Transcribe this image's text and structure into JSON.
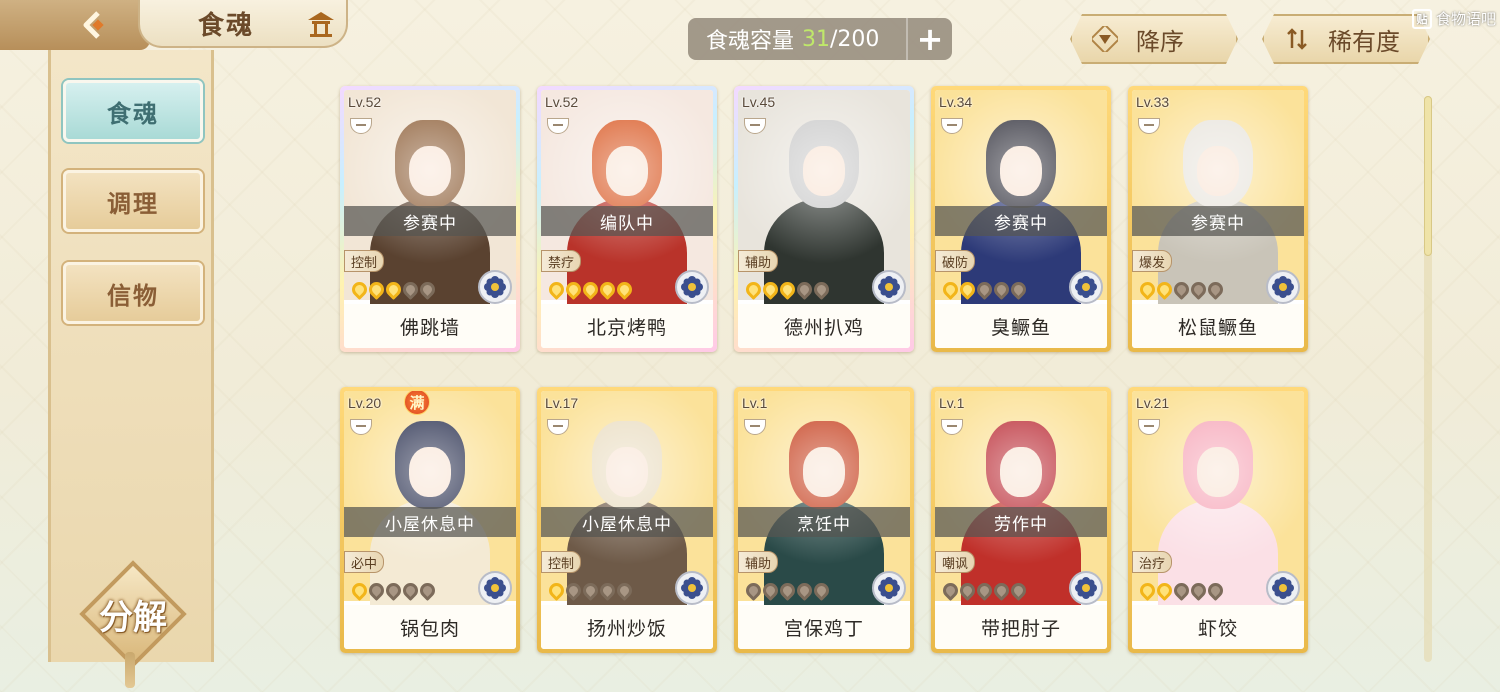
{
  "header": {
    "title": "食魂",
    "capacity_label": "食魂容量",
    "capacity_current": "31",
    "capacity_max": "/200",
    "add_label": "+",
    "sort_desc_label": "降序",
    "sort_rarity_label": "稀有度",
    "watermark_text": "食物语吧",
    "watermark_icon_text": "贴"
  },
  "sidebar": {
    "tabs": [
      {
        "label": "食魂",
        "active": true
      },
      {
        "label": "调理",
        "active": false
      },
      {
        "label": "信物",
        "active": false
      }
    ],
    "decompose_label": "分解"
  },
  "colors": {
    "gold_frame": "#e9b94a",
    "capacity_accent": "#bfe86a",
    "active_tab": "#a9dad6"
  },
  "cards": [
    {
      "name": "佛跳墙",
      "level": "Lv.52",
      "status": "参赛中",
      "role": "控制",
      "stars": 3,
      "frame": "rainbow",
      "full": false,
      "hair": "#8a5a32",
      "outfit": "#5a4230",
      "bg": "#f2e6d6"
    },
    {
      "name": "北京烤鸭",
      "level": "Lv.52",
      "status": "编队中",
      "role": "禁疗",
      "stars": 5,
      "frame": "rainbow",
      "full": false,
      "hair": "#d8541e",
      "outfit": "#b9332a",
      "bg": "#f5e8e0"
    },
    {
      "name": "德州扒鸡",
      "level": "Lv.45",
      "status": "",
      "role": "辅助",
      "stars": 3,
      "frame": "rainbow",
      "full": false,
      "hair": "#c9c9c9",
      "outfit": "#2f3530",
      "bg": "#e8e4dc"
    },
    {
      "name": "臭鳜鱼",
      "level": "Lv.34",
      "status": "参赛中",
      "role": "破防",
      "stars": 2,
      "frame": "gold",
      "full": false,
      "hair": "#2b2b36",
      "outfit": "#2d3a78",
      "bg": "#fbe29a"
    },
    {
      "name": "松鼠鳜鱼",
      "level": "Lv.33",
      "status": "参赛中",
      "role": "爆发",
      "stars": 2,
      "frame": "gold",
      "full": false,
      "hair": "#e8e4dc",
      "outfit": "#c9c4b8",
      "bg": "#fbe29a"
    },
    {
      "name": "锅包肉",
      "level": "Lv.20",
      "status": "小屋休息中",
      "role": "必中",
      "stars": 1,
      "frame": "gold",
      "full": true,
      "full_label": "满",
      "hair": "#232a4a",
      "outfit": "#f4ead4",
      "bg": "#fbe29a"
    },
    {
      "name": "扬州炒饭",
      "level": "Lv.17",
      "status": "小屋休息中",
      "role": "控制",
      "stars": 1,
      "frame": "gold",
      "full": false,
      "hair": "#e9dcc0",
      "outfit": "#6e5a48",
      "bg": "#fbe29a"
    },
    {
      "name": "宫保鸡丁",
      "level": "Lv.1",
      "status": "烹饪中",
      "role": "辅助",
      "stars": 0,
      "frame": "gold",
      "full": false,
      "hair": "#c43a18",
      "outfit": "#2a4a48",
      "bg": "#fbe29a"
    },
    {
      "name": "带把肘子",
      "level": "Lv.1",
      "status": "劳作中",
      "role": "嘲讽",
      "stars": 0,
      "frame": "gold",
      "full": false,
      "hair": "#b8242e",
      "outfit": "#c0302a",
      "bg": "#fbe29a"
    },
    {
      "name": "虾饺",
      "level": "Lv.21",
      "status": "",
      "role": "治疗",
      "stars": 2,
      "frame": "gold",
      "full": false,
      "hair": "#f6a4b6",
      "outfit": "#fbe0e6",
      "bg": "#fbe29a"
    }
  ]
}
